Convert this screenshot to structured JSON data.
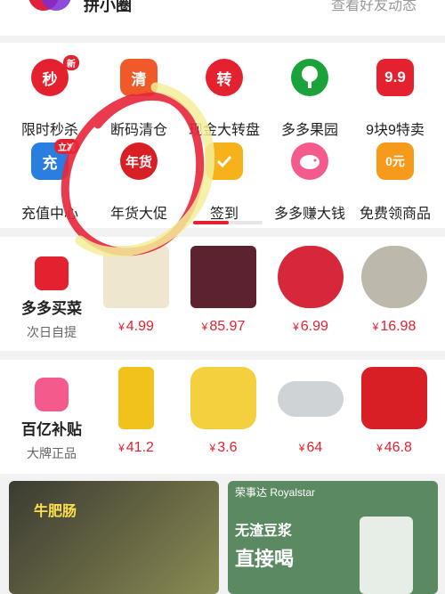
{
  "header": {
    "app_title": "拼小圈",
    "friends_link": "查看好友动态"
  },
  "grid": [
    {
      "label": "限时秒杀",
      "icon_text": "秒",
      "icon": "alarm-clock-icon",
      "color": "#e3212f",
      "badge": "新"
    },
    {
      "label": "断码清仓",
      "icon_text": "清",
      "icon": "truck-icon",
      "color": "#f05a28",
      "badge": ""
    },
    {
      "label": "现金大转盘",
      "icon_text": "转",
      "icon": "wheel-icon",
      "color": "#e3212f",
      "badge": ""
    },
    {
      "label": "多多果园",
      "icon_text": "",
      "icon": "tree-icon",
      "color": "#19a33a",
      "badge": ""
    },
    {
      "label": "9块9特卖",
      "icon_text": "9.9",
      "icon": "tag-icon",
      "color": "#e3212f",
      "badge": ""
    },
    {
      "label": "充值中心",
      "icon_text": "充",
      "icon": "phone-icon",
      "color": "#2a7de1",
      "badge": "立减"
    },
    {
      "label": "年货大促",
      "icon_text": "年货",
      "icon": "lantern-icon",
      "color": "#d91f26",
      "badge": ""
    },
    {
      "label": "签到",
      "icon_text": "",
      "icon": "calendar-check-icon",
      "color": "#f7b21b",
      "badge": ""
    },
    {
      "label": "多多赚大钱",
      "icon_text": "",
      "icon": "piggy-bank-icon",
      "color": "#f45b8c",
      "badge": ""
    },
    {
      "label": "免费领商品",
      "icon_text": "0元",
      "icon": "gift-bag-icon",
      "color": "#f59a1b",
      "badge": ""
    }
  ],
  "row1": {
    "name": "多多买菜",
    "sub": "次日自提",
    "products": [
      {
        "price": "4.99",
        "icon": "garlic-icon",
        "color": "#efe6cf"
      },
      {
        "price": "85.97",
        "icon": "cherries-icon",
        "color": "#5d2230"
      },
      {
        "price": "6.99",
        "icon": "wax-apple-icon",
        "color": "#d6283a"
      },
      {
        "price": "16.98",
        "icon": "oysters-icon",
        "color": "#bcb8ac"
      }
    ]
  },
  "row2": {
    "name": "百亿补贴",
    "sub": "大牌正品",
    "products": [
      {
        "price": "41.2",
        "icon": "oil-bottle-icon",
        "color": "#f1c21b"
      },
      {
        "price": "3.6",
        "icon": "electric-pot-icon",
        "color": "#f4d03f"
      },
      {
        "price": "64",
        "icon": "induction-cooker-icon",
        "color": "#cfd3d6"
      },
      {
        "price": "46.8",
        "icon": "sweater-icon",
        "color": "#d91f26"
      }
    ]
  },
  "currency": "¥",
  "banners": {
    "left_tag": "牛肥肠",
    "right_brand": "荣事达 Royalstar",
    "right_line1": "无渣豆浆",
    "right_line2": "直接喝"
  }
}
